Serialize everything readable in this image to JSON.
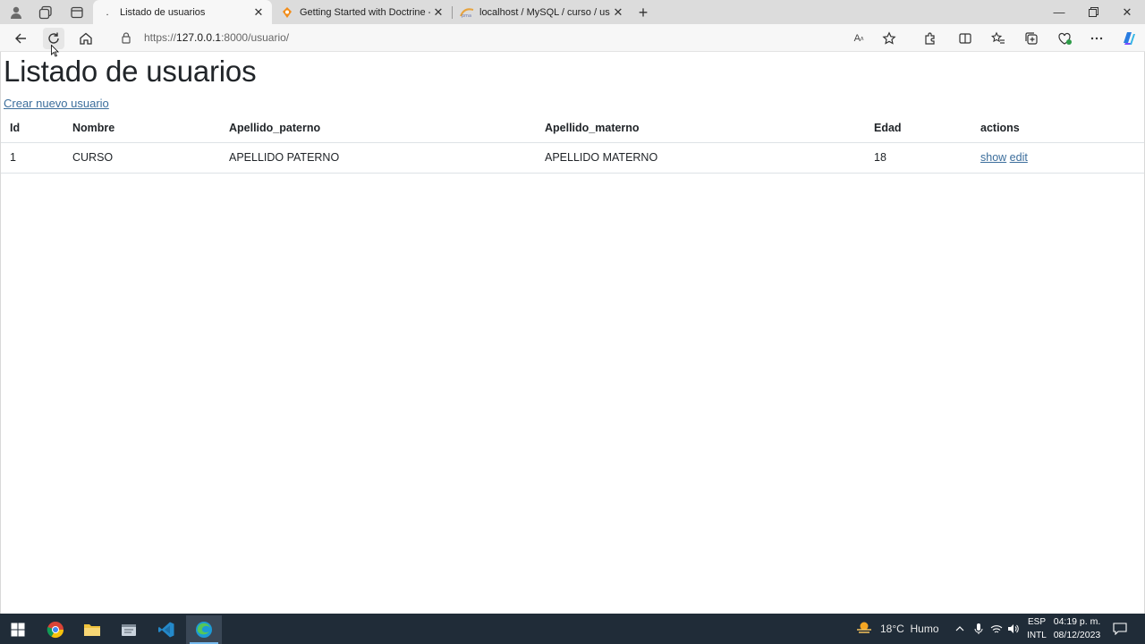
{
  "browser": {
    "tabs": [
      {
        "title": "Listado de usuarios",
        "favicon": "dot"
      },
      {
        "title": "Getting Started with Doctrine - D",
        "favicon": "doctrine-icon"
      },
      {
        "title": "localhost / MySQL / curso / usua",
        "favicon": "phpmyadmin-icon"
      }
    ],
    "url_prefix": "https://",
    "url_host": "127.0.0.1",
    "url_rest": ":8000/usuario/"
  },
  "page": {
    "heading": "Listado de usuarios",
    "create_link": "Crear nuevo usuario",
    "table": {
      "headers": [
        "Id",
        "Nombre",
        "Apellido_paterno",
        "Apellido_materno",
        "Edad",
        "actions"
      ],
      "rows": [
        {
          "id": "1",
          "nombre": "CURSO",
          "apellido_paterno": "APELLIDO PATERNO",
          "apellido_materno": "APELLIDO MATERNO",
          "edad": "18",
          "show": "show",
          "edit": "edit"
        }
      ]
    }
  },
  "taskbar": {
    "weather": "18°C  Humo",
    "lang_top": "ESP",
    "lang_bottom": "INTL",
    "time": "04:19 p. m.",
    "date": "08/12/2023"
  },
  "colors": {
    "link": "#3c6e9c",
    "taskbar_bg": "#202c38",
    "tabstrip_bg": "#dcdcdc"
  }
}
